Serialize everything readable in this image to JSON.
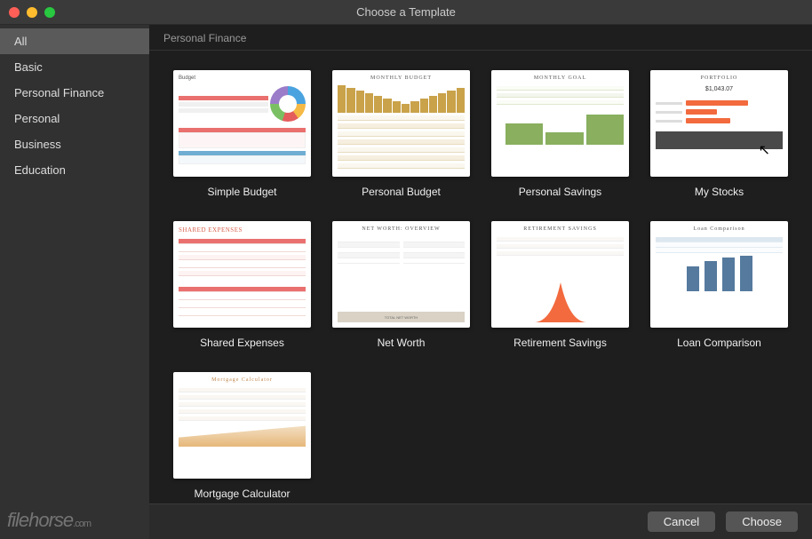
{
  "window": {
    "title": "Choose a Template"
  },
  "sidebar": {
    "items": [
      {
        "label": "All",
        "selected": true
      },
      {
        "label": "Basic",
        "selected": false
      },
      {
        "label": "Personal Finance",
        "selected": false
      },
      {
        "label": "Personal",
        "selected": false
      },
      {
        "label": "Business",
        "selected": false
      },
      {
        "label": "Education",
        "selected": false
      }
    ]
  },
  "section": {
    "title": "Personal Finance"
  },
  "templates": [
    {
      "label": "Simple Budget",
      "thumb": {
        "title": "Budget",
        "style": "donut"
      }
    },
    {
      "label": "Personal Budget",
      "thumb": {
        "title": "MONTHLY BUDGET",
        "style": "goldbars"
      }
    },
    {
      "label": "Personal Savings",
      "thumb": {
        "title": "MONTHLY GOAL",
        "style": "greenbars"
      }
    },
    {
      "label": "My Stocks",
      "thumb": {
        "title": "PORTFOLIO",
        "style": "hbar",
        "value": "$1,043.07"
      }
    },
    {
      "label": "Shared Expenses",
      "thumb": {
        "title": "SHARED EXPENSES",
        "style": "redtable"
      }
    },
    {
      "label": "Net Worth",
      "thumb": {
        "title": "NET WORTH: OVERVIEW",
        "style": "networth",
        "footer": "TOTAL NET WORTH"
      }
    },
    {
      "label": "Retirement Savings",
      "thumb": {
        "title": "RETIREMENT SAVINGS",
        "style": "curve"
      }
    },
    {
      "label": "Loan Comparison",
      "thumb": {
        "title": "Loan Comparison",
        "style": "bluecols"
      }
    },
    {
      "label": "Mortgage Calculator",
      "thumb": {
        "title": "Mortgage Calculator",
        "style": "mortgage"
      }
    }
  ],
  "footer": {
    "cancel": "Cancel",
    "choose": "Choose"
  },
  "watermark": "filehorse"
}
